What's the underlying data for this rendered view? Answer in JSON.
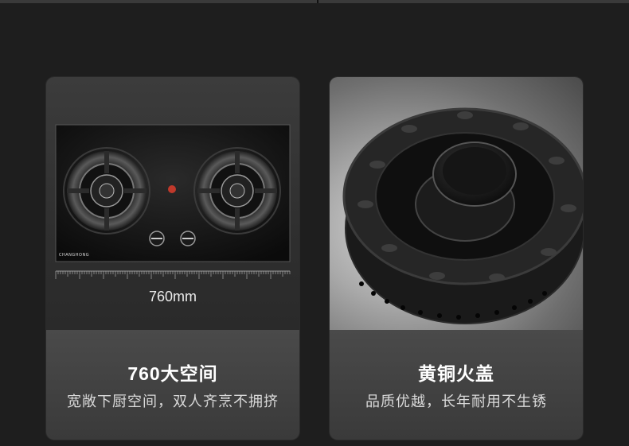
{
  "cards": [
    {
      "measure_label": "760mm",
      "brand_mark": "CHANGHONG",
      "title": "760大空间",
      "subtitle": "宽敞下厨空间，双人齐烹不拥挤"
    },
    {
      "title": "黄铜火盖",
      "subtitle": "品质优越，长年耐用不生锈"
    }
  ],
  "colors": {
    "page_background": "#1e1e1e",
    "caption_background": "#444444",
    "title_text": "#ffffff",
    "subtitle_text": "#d9d9d9",
    "ignition_red": "#c0392b"
  },
  "icons": [
    "stove-burner-icon",
    "control-knob-icon",
    "ruler-icon",
    "brass-burner-cap-icon"
  ]
}
